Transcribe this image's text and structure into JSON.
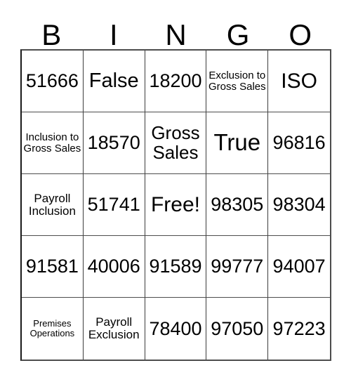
{
  "card": {
    "headers": [
      "B",
      "I",
      "N",
      "G",
      "O"
    ],
    "free_space_label": "Free!",
    "colors": {
      "background": "#ffffff",
      "text": "#000000",
      "grid_line": "#4d4d4d"
    },
    "rows": [
      [
        {
          "text": "51666",
          "size": "sz-num"
        },
        {
          "text": "False",
          "size": "sz-word"
        },
        {
          "text": "18200",
          "size": "sz-num"
        },
        {
          "text": "Exclusion to Gross Sales",
          "size": "sz-sm"
        },
        {
          "text": "ISO",
          "size": "sz-lg"
        }
      ],
      [
        {
          "text": "Inclusion to Gross Sales",
          "size": "sz-sm"
        },
        {
          "text": "18570",
          "size": "sz-num"
        },
        {
          "text": "Gross Sales",
          "size": "sz-two"
        },
        {
          "text": "True",
          "size": "sz-xl"
        },
        {
          "text": "96816",
          "size": "sz-num"
        }
      ],
      [
        {
          "text": "Payroll Inclusion",
          "size": "sz-md"
        },
        {
          "text": "51741",
          "size": "sz-num"
        },
        {
          "text": "Free!",
          "size": "sz-lg"
        },
        {
          "text": "98305",
          "size": "sz-num"
        },
        {
          "text": "98304",
          "size": "sz-num"
        }
      ],
      [
        {
          "text": "91581",
          "size": "sz-num"
        },
        {
          "text": "40006",
          "size": "sz-num"
        },
        {
          "text": "91589",
          "size": "sz-num"
        },
        {
          "text": "99777",
          "size": "sz-num"
        },
        {
          "text": "94007",
          "size": "sz-num"
        }
      ],
      [
        {
          "text": "Premises Operations",
          "size": "sz-xs"
        },
        {
          "text": "Payroll Exclusion",
          "size": "sz-md"
        },
        {
          "text": "78400",
          "size": "sz-num"
        },
        {
          "text": "97050",
          "size": "sz-num"
        },
        {
          "text": "97223",
          "size": "sz-num"
        }
      ]
    ]
  }
}
